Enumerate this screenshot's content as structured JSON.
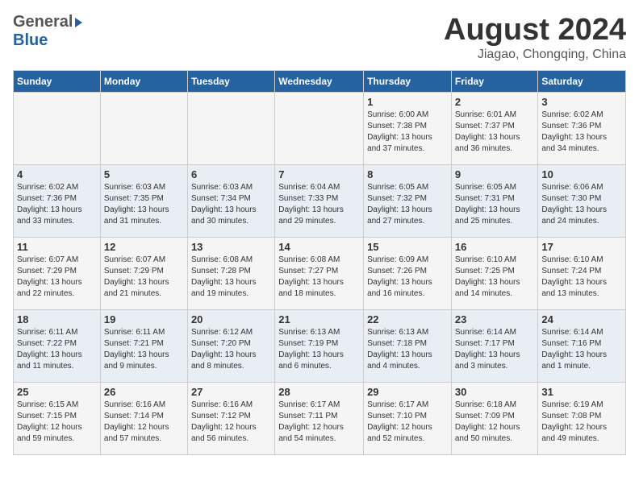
{
  "header": {
    "logo_general": "General",
    "logo_blue": "Blue",
    "month_title": "August 2024",
    "location": "Jiagao, Chongqing, China"
  },
  "columns": [
    "Sunday",
    "Monday",
    "Tuesday",
    "Wednesday",
    "Thursday",
    "Friday",
    "Saturday"
  ],
  "weeks": [
    [
      {
        "day": "",
        "info": ""
      },
      {
        "day": "",
        "info": ""
      },
      {
        "day": "",
        "info": ""
      },
      {
        "day": "",
        "info": ""
      },
      {
        "day": "1",
        "info": "Sunrise: 6:00 AM\nSunset: 7:38 PM\nDaylight: 13 hours\nand 37 minutes."
      },
      {
        "day": "2",
        "info": "Sunrise: 6:01 AM\nSunset: 7:37 PM\nDaylight: 13 hours\nand 36 minutes."
      },
      {
        "day": "3",
        "info": "Sunrise: 6:02 AM\nSunset: 7:36 PM\nDaylight: 13 hours\nand 34 minutes."
      }
    ],
    [
      {
        "day": "4",
        "info": "Sunrise: 6:02 AM\nSunset: 7:36 PM\nDaylight: 13 hours\nand 33 minutes."
      },
      {
        "day": "5",
        "info": "Sunrise: 6:03 AM\nSunset: 7:35 PM\nDaylight: 13 hours\nand 31 minutes."
      },
      {
        "day": "6",
        "info": "Sunrise: 6:03 AM\nSunset: 7:34 PM\nDaylight: 13 hours\nand 30 minutes."
      },
      {
        "day": "7",
        "info": "Sunrise: 6:04 AM\nSunset: 7:33 PM\nDaylight: 13 hours\nand 29 minutes."
      },
      {
        "day": "8",
        "info": "Sunrise: 6:05 AM\nSunset: 7:32 PM\nDaylight: 13 hours\nand 27 minutes."
      },
      {
        "day": "9",
        "info": "Sunrise: 6:05 AM\nSunset: 7:31 PM\nDaylight: 13 hours\nand 25 minutes."
      },
      {
        "day": "10",
        "info": "Sunrise: 6:06 AM\nSunset: 7:30 PM\nDaylight: 13 hours\nand 24 minutes."
      }
    ],
    [
      {
        "day": "11",
        "info": "Sunrise: 6:07 AM\nSunset: 7:29 PM\nDaylight: 13 hours\nand 22 minutes."
      },
      {
        "day": "12",
        "info": "Sunrise: 6:07 AM\nSunset: 7:29 PM\nDaylight: 13 hours\nand 21 minutes."
      },
      {
        "day": "13",
        "info": "Sunrise: 6:08 AM\nSunset: 7:28 PM\nDaylight: 13 hours\nand 19 minutes."
      },
      {
        "day": "14",
        "info": "Sunrise: 6:08 AM\nSunset: 7:27 PM\nDaylight: 13 hours\nand 18 minutes."
      },
      {
        "day": "15",
        "info": "Sunrise: 6:09 AM\nSunset: 7:26 PM\nDaylight: 13 hours\nand 16 minutes."
      },
      {
        "day": "16",
        "info": "Sunrise: 6:10 AM\nSunset: 7:25 PM\nDaylight: 13 hours\nand 14 minutes."
      },
      {
        "day": "17",
        "info": "Sunrise: 6:10 AM\nSunset: 7:24 PM\nDaylight: 13 hours\nand 13 minutes."
      }
    ],
    [
      {
        "day": "18",
        "info": "Sunrise: 6:11 AM\nSunset: 7:22 PM\nDaylight: 13 hours\nand 11 minutes."
      },
      {
        "day": "19",
        "info": "Sunrise: 6:11 AM\nSunset: 7:21 PM\nDaylight: 13 hours\nand 9 minutes."
      },
      {
        "day": "20",
        "info": "Sunrise: 6:12 AM\nSunset: 7:20 PM\nDaylight: 13 hours\nand 8 minutes."
      },
      {
        "day": "21",
        "info": "Sunrise: 6:13 AM\nSunset: 7:19 PM\nDaylight: 13 hours\nand 6 minutes."
      },
      {
        "day": "22",
        "info": "Sunrise: 6:13 AM\nSunset: 7:18 PM\nDaylight: 13 hours\nand 4 minutes."
      },
      {
        "day": "23",
        "info": "Sunrise: 6:14 AM\nSunset: 7:17 PM\nDaylight: 13 hours\nand 3 minutes."
      },
      {
        "day": "24",
        "info": "Sunrise: 6:14 AM\nSunset: 7:16 PM\nDaylight: 13 hours\nand 1 minute."
      }
    ],
    [
      {
        "day": "25",
        "info": "Sunrise: 6:15 AM\nSunset: 7:15 PM\nDaylight: 12 hours\nand 59 minutes."
      },
      {
        "day": "26",
        "info": "Sunrise: 6:16 AM\nSunset: 7:14 PM\nDaylight: 12 hours\nand 57 minutes."
      },
      {
        "day": "27",
        "info": "Sunrise: 6:16 AM\nSunset: 7:12 PM\nDaylight: 12 hours\nand 56 minutes."
      },
      {
        "day": "28",
        "info": "Sunrise: 6:17 AM\nSunset: 7:11 PM\nDaylight: 12 hours\nand 54 minutes."
      },
      {
        "day": "29",
        "info": "Sunrise: 6:17 AM\nSunset: 7:10 PM\nDaylight: 12 hours\nand 52 minutes."
      },
      {
        "day": "30",
        "info": "Sunrise: 6:18 AM\nSunset: 7:09 PM\nDaylight: 12 hours\nand 50 minutes."
      },
      {
        "day": "31",
        "info": "Sunrise: 6:19 AM\nSunset: 7:08 PM\nDaylight: 12 hours\nand 49 minutes."
      }
    ]
  ]
}
